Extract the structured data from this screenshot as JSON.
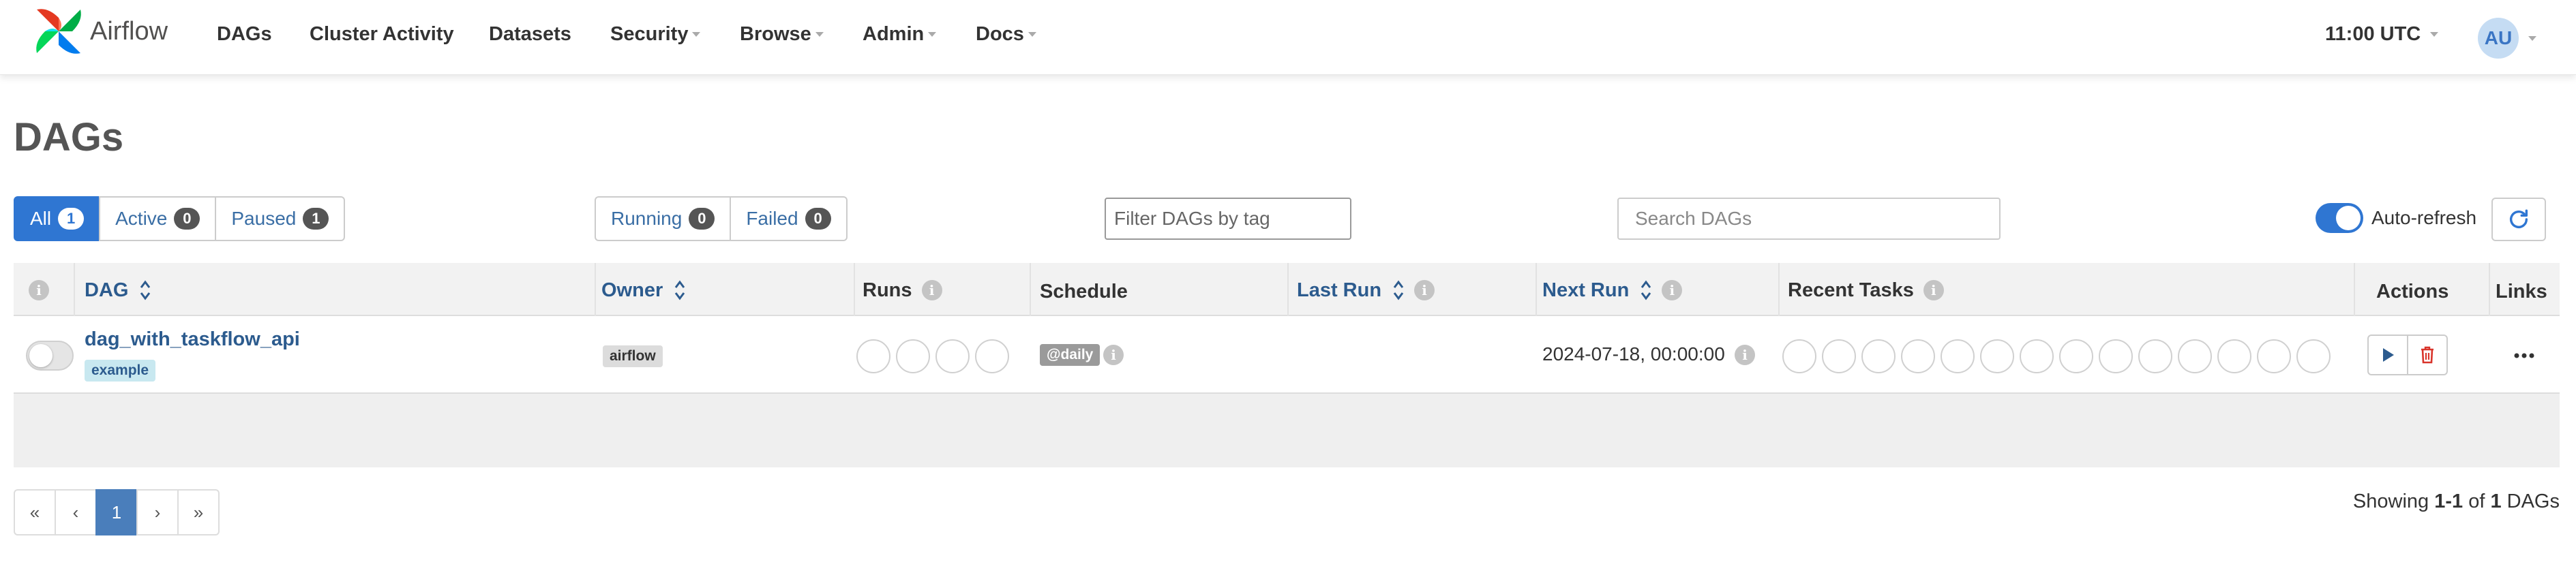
{
  "brand": {
    "name": "Airflow"
  },
  "nav": {
    "items": [
      {
        "label": "DAGs",
        "dropdown": false
      },
      {
        "label": "Cluster Activity",
        "dropdown": false
      },
      {
        "label": "Datasets",
        "dropdown": false
      },
      {
        "label": "Security",
        "dropdown": true
      },
      {
        "label": "Browse",
        "dropdown": true
      },
      {
        "label": "Admin",
        "dropdown": true
      },
      {
        "label": "Docs",
        "dropdown": true
      }
    ],
    "clock": "11:00 UTC",
    "user_initials": "AU"
  },
  "page": {
    "title": "DAGs"
  },
  "status_filters": [
    {
      "label": "All",
      "count": "1",
      "active": true
    },
    {
      "label": "Active",
      "count": "0",
      "active": false
    },
    {
      "label": "Paused",
      "count": "1",
      "active": false
    }
  ],
  "run_filters": [
    {
      "label": "Running",
      "count": "0"
    },
    {
      "label": "Failed",
      "count": "0"
    }
  ],
  "tag_filter": {
    "placeholder": "Filter DAGs by tag"
  },
  "search": {
    "placeholder": "Search DAGs"
  },
  "auto_refresh": {
    "label": "Auto-refresh",
    "enabled": true
  },
  "table": {
    "headers": {
      "dag": "DAG",
      "owner": "Owner",
      "runs": "Runs",
      "schedule": "Schedule",
      "last_run": "Last Run",
      "next_run": "Next Run",
      "recent_tasks": "Recent Tasks",
      "actions": "Actions",
      "links": "Links"
    },
    "rows": [
      {
        "dag_id": "dag_with_taskflow_api",
        "tag": "example",
        "owner": "airflow",
        "schedule": "@daily",
        "last_run": "",
        "next_run": "2024-07-18, 00:00:00",
        "paused": true,
        "run_circles": 4,
        "task_circles": 14
      }
    ]
  },
  "pagination": {
    "first": "«",
    "prev": "‹",
    "current": "1",
    "next": "›",
    "last": "»"
  },
  "summary": {
    "prefix": "Showing ",
    "range": "1-1",
    "middle": " of ",
    "total": "1",
    "suffix": " DAGs"
  },
  "colors": {
    "accent": "#2f76d2",
    "link": "#2c5b8e",
    "tag_bg": "#c8e8f0",
    "delete": "#d9342b",
    "logo_red": "#e43921",
    "logo_green": "#00ad46",
    "logo_blue": "#017cee",
    "logo_teal": "#04d659"
  },
  "icons": {
    "refresh": "refresh-icon",
    "trigger": "play-icon",
    "delete": "trash-icon",
    "links": "more-horizontal-icon"
  }
}
